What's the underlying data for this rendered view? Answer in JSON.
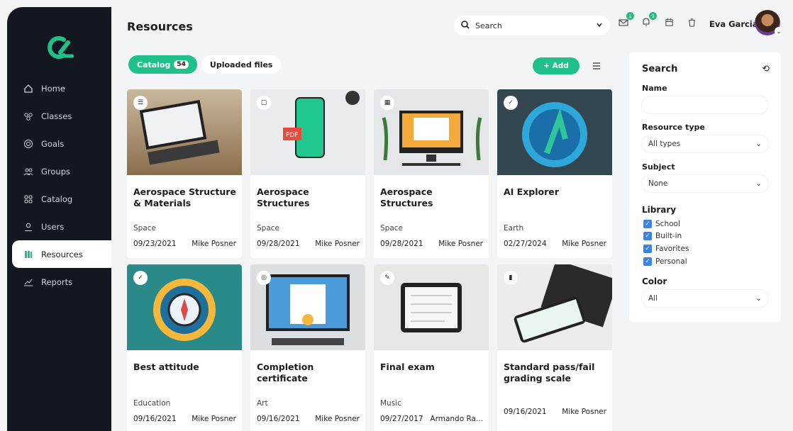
{
  "app": {
    "logo_alt": "logo"
  },
  "sidebar": {
    "items": [
      {
        "label": "Home",
        "icon": "home-icon"
      },
      {
        "label": "Classes",
        "icon": "classes-icon"
      },
      {
        "label": "Goals",
        "icon": "goals-icon"
      },
      {
        "label": "Groups",
        "icon": "groups-icon"
      },
      {
        "label": "Catalog",
        "icon": "catalog-icon"
      },
      {
        "label": "Users",
        "icon": "users-icon"
      },
      {
        "label": "Resources",
        "icon": "resources-icon",
        "active": true
      },
      {
        "label": "Reports",
        "icon": "reports-icon"
      }
    ]
  },
  "header": {
    "title": "Resources",
    "search_label": "Search",
    "badges": {
      "messages": "1",
      "notifications": "9"
    },
    "user_name": "Eva Garcia"
  },
  "tabs": {
    "catalog_label": "Catalog",
    "catalog_count": "54",
    "uploaded_label": "Uploaded files"
  },
  "toolbar": {
    "add_label": "+ Add"
  },
  "cards": [
    {
      "title": "Aerospace Structure & Materials",
      "subject": "Space",
      "date": "09/23/2021",
      "author": "Mike Posner",
      "type_icon": "list-icon"
    },
    {
      "title": "Aerospace Structures",
      "subject": "Space",
      "date": "09/28/2021",
      "author": "Mike Posner",
      "type_icon": "pdf-icon"
    },
    {
      "title": "Aerospace Structures",
      "subject": "Space",
      "date": "09/28/2021",
      "author": "Mike Posner",
      "type_icon": "video-icon"
    },
    {
      "title": "AI Explorer",
      "subject": "Earth",
      "date": "02/27/2024",
      "author": "Mike Posner",
      "type_icon": "badge-icon"
    },
    {
      "title": "Best attitude",
      "subject": "Education",
      "date": "09/16/2021",
      "author": "Mike Posner",
      "type_icon": "badge-icon"
    },
    {
      "title": "Completion certificate",
      "subject": "Art",
      "date": "09/16/2021",
      "author": "Mike Posner",
      "type_icon": "certificate-icon"
    },
    {
      "title": "Final exam",
      "subject": "Music",
      "date": "09/27/2017",
      "author": "Armando Ra...",
      "type_icon": "exam-icon"
    },
    {
      "title": "Standard pass/fail grading scale",
      "subject": "",
      "date": "09/16/2021",
      "author": "Mike Posner",
      "type_icon": "grading-icon"
    }
  ],
  "filters": {
    "title": "Search",
    "name_label": "Name",
    "name_value": "",
    "resource_type_label": "Resource type",
    "resource_type_value": "All types",
    "subject_label": "Subject",
    "subject_value": "None",
    "library_label": "Library",
    "library_options": [
      {
        "label": "School",
        "checked": true
      },
      {
        "label": "Built-in",
        "checked": true
      },
      {
        "label": "Favorites",
        "checked": true
      },
      {
        "label": "Personal",
        "checked": true
      }
    ],
    "color_label": "Color",
    "color_value": "All"
  },
  "colors": {
    "accent": "#1fc089",
    "sidebar": "#131820",
    "checkbox": "#3b82e3"
  }
}
